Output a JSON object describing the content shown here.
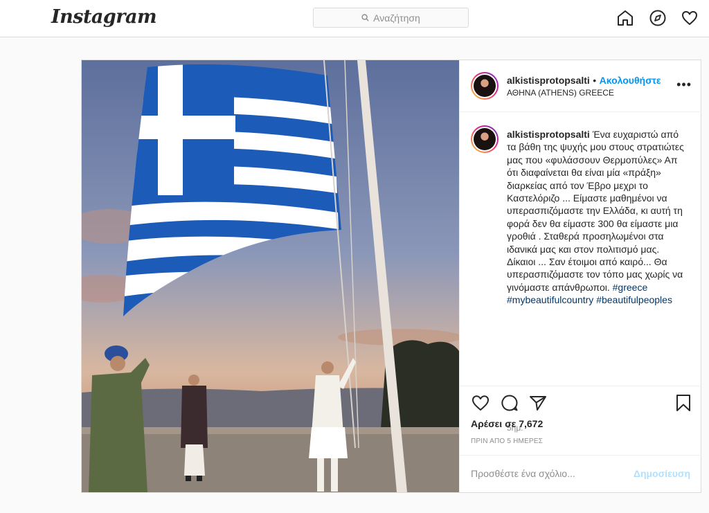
{
  "nav": {
    "logo": "Instagram",
    "search_placeholder": "Αναζήτηση",
    "icons": [
      "home-icon",
      "explore-icon",
      "heart-icon"
    ]
  },
  "post": {
    "username": "alkistisprotopsalti",
    "separator": "•",
    "follow_label": "Ακολουθήστε",
    "location": "ΑΘΗΝΑ (ATHENS) GREECE",
    "more_label": "•••",
    "caption_username": "alkistisprotopsalti",
    "caption_text": "Ένα ευχαριστώ από τα βάθη της ψυχής μου στους στρατιώτες μας που «φυλάσσουν Θερμοπύλες» Απ ότι διαφαίνεται θα είναι μία «πράξη» διαρκείας από τον Έβρο μεχρι το Καστελόριζο ... Είμαστε μαθημένοι να υπερασπιζόμαστε την Ελλάδα, κι αυτή τη φορά δεν θα είμαστε 300 θα είμαστε μια γροθιά . Σταθερά προσηλωμένοι στα ιδανικά μας και στον πολιτισμό μας. Δίκαιοι ... Σαν έτοιμοι από καιρό... Θα υπερασπιζόμαστε τον τόπο μας χωρίς να γινόμαστε απάνθρωποι.",
    "hashtags": [
      "#greece",
      "#mybeautifulcountry",
      "#beautifulpeoples"
    ],
    "caption_time": "5ημ.",
    "likes": "Αρέσει σε 7,672",
    "posted_ago": "ΠΡΙΝ ΑΠΟ 5 ΗΜΕΡΕΣ",
    "comment_placeholder": "Προσθέστε ένα σχόλιο...",
    "publish_label": "Δημοσίευση",
    "action_icons": [
      "heart-icon",
      "comment-icon",
      "share-icon",
      "save-icon"
    ]
  },
  "colors": {
    "accent": "#0095f6",
    "hashtag": "#00376b",
    "muted": "#8e8e8e",
    "border": "#dbdbdb",
    "flag_blue": "#1c5bb8"
  }
}
